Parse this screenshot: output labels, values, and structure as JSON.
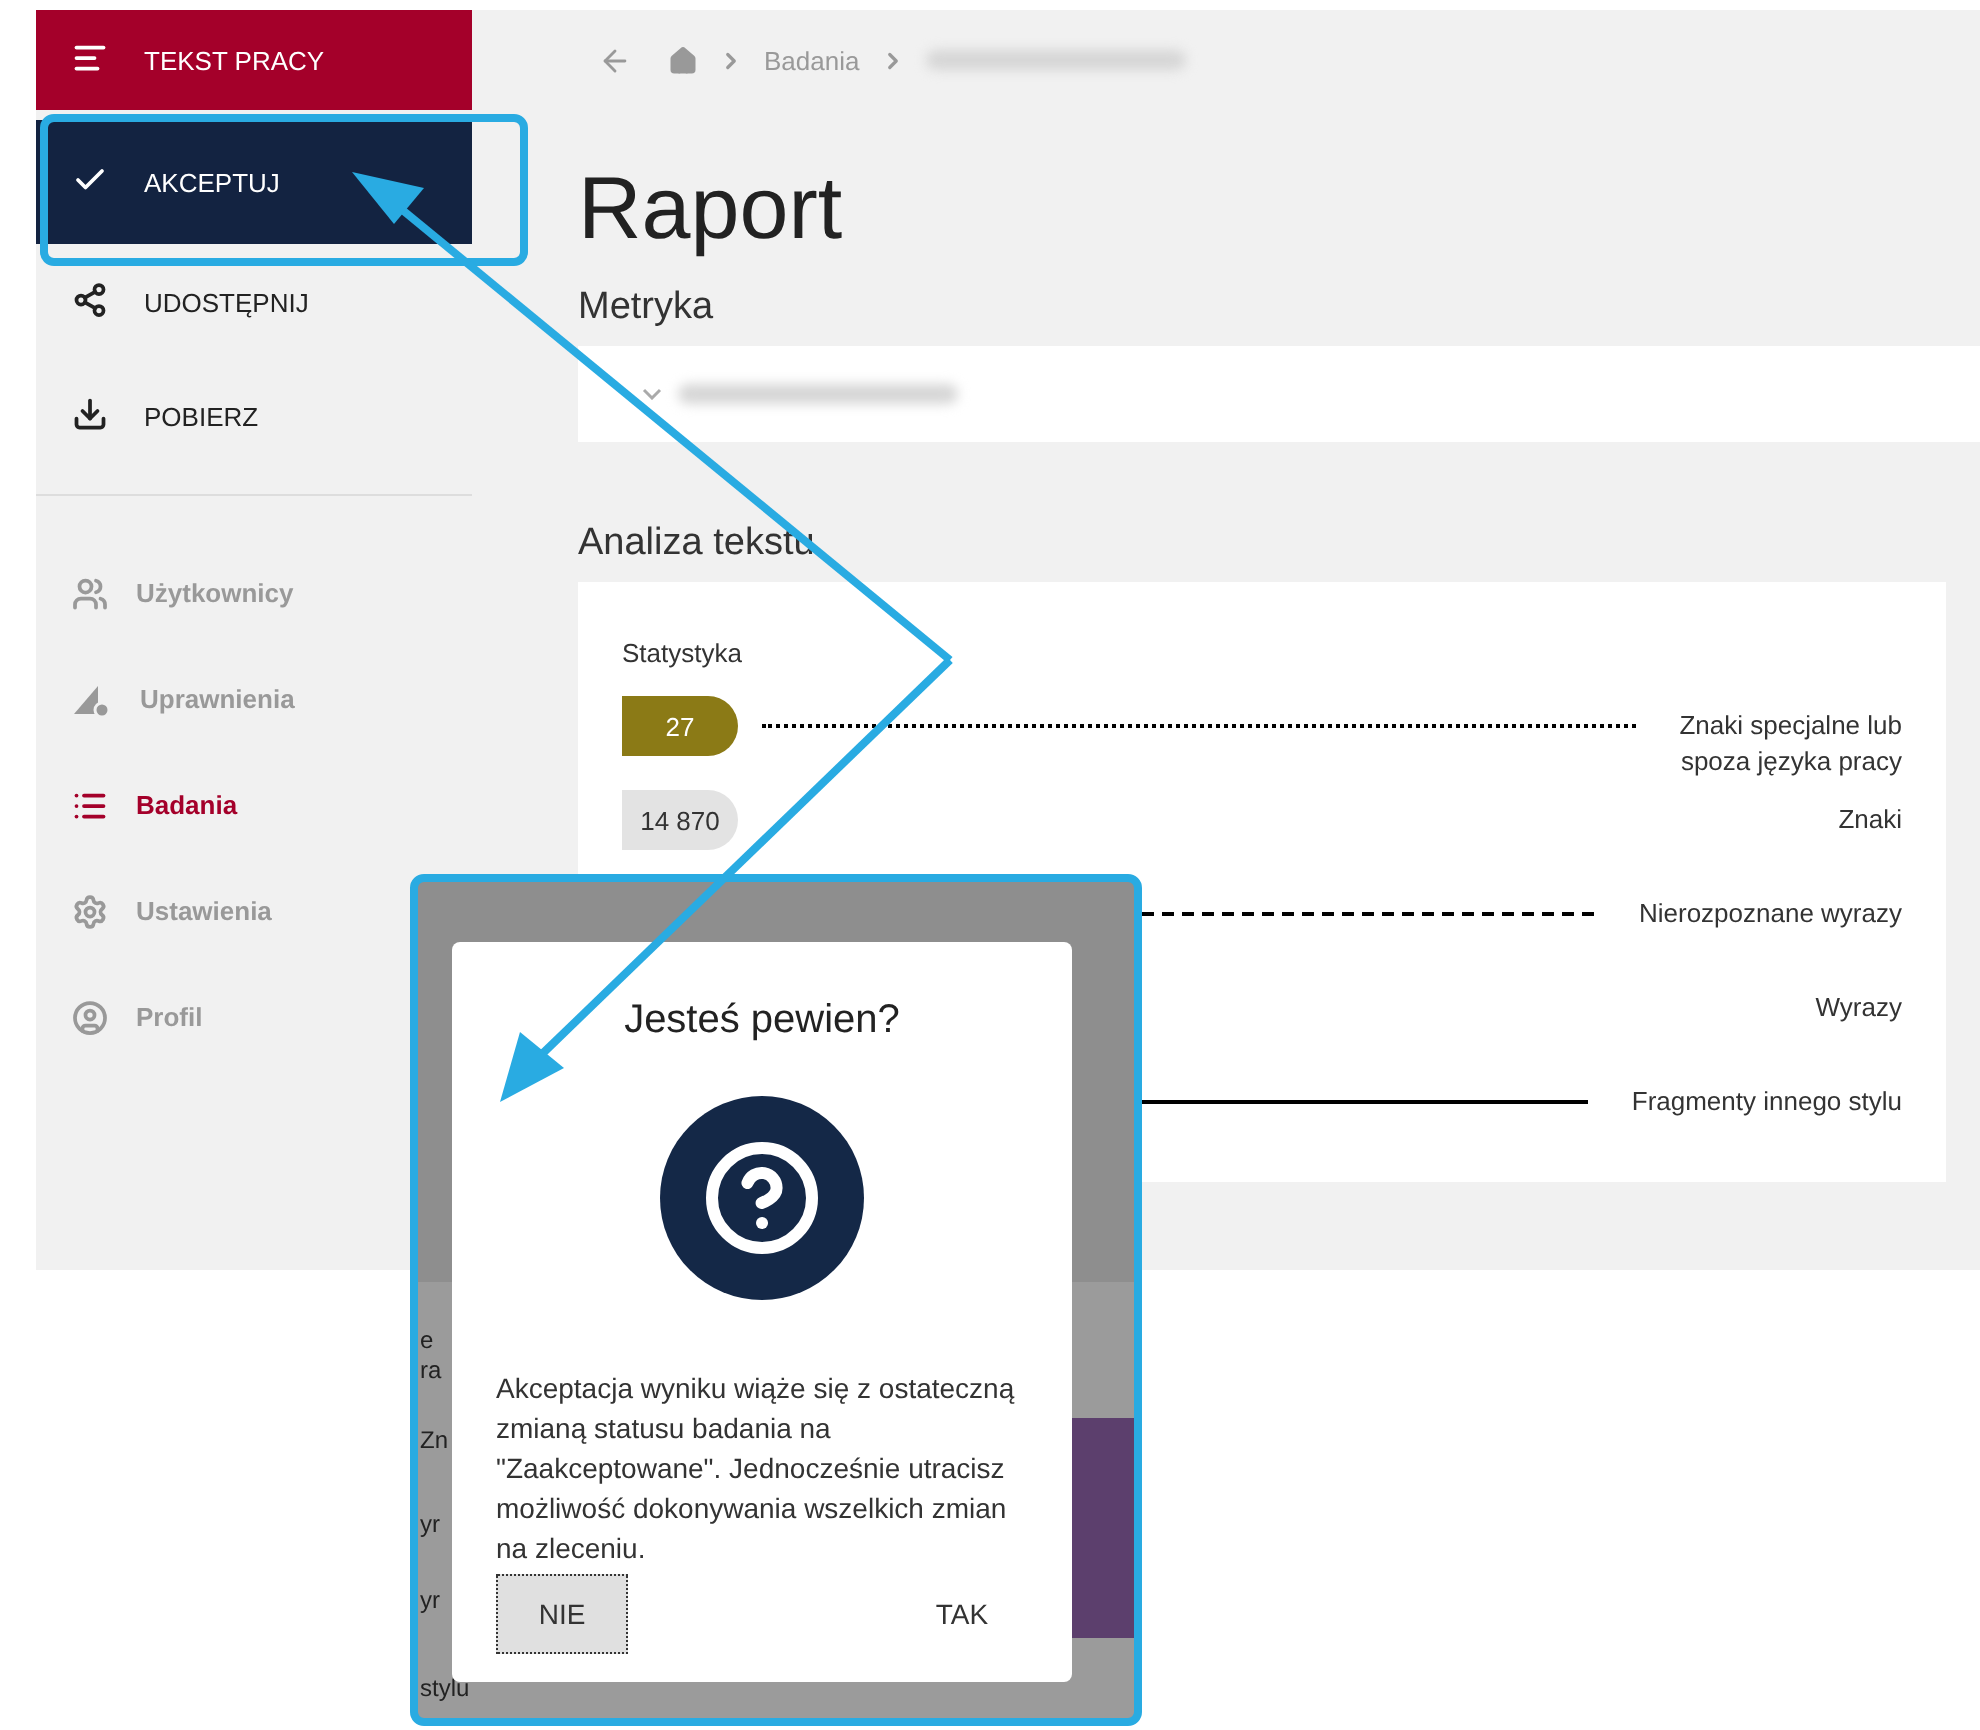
{
  "sidebar": {
    "actions": [
      {
        "label": "TEKST PRACY",
        "kind": "text"
      },
      {
        "label": "AKCEPTUJ",
        "kind": "accept"
      },
      {
        "label": "UDOSTĘPNIJ",
        "kind": "share"
      },
      {
        "label": "POBIERZ",
        "kind": "download"
      }
    ],
    "nav": [
      {
        "label": "Użytkownicy",
        "kind": "users",
        "selected": false
      },
      {
        "label": "Uprawnienia",
        "kind": "permissions",
        "selected": false
      },
      {
        "label": "Badania",
        "kind": "list",
        "selected": true
      },
      {
        "label": "Ustawienia",
        "kind": "settings",
        "selected": false
      },
      {
        "label": "Profil",
        "kind": "profile",
        "selected": false
      }
    ]
  },
  "breadcrumb": [
    "Badania"
  ],
  "page_title": "Raport",
  "metryka": {
    "title": "Metryka"
  },
  "analysis": {
    "title": "Analiza tekstu",
    "card_title": "Statystyka",
    "rows": [
      {
        "value": "27",
        "label": "Znaki specjalne lub\nspoza języka pracy",
        "kind": "dotted",
        "color": "#8b7a16"
      },
      {
        "value": "14 870",
        "label": "Znaki",
        "kind": "none",
        "color": "#e3e3e3"
      },
      {
        "label": "Nierozpoznane wyrazy",
        "kind": "dashed"
      },
      {
        "label": "Wyrazy",
        "kind": "none"
      },
      {
        "label": "Fragmenty innego stylu",
        "kind": "solid"
      }
    ]
  },
  "inset": {
    "background_labels": [
      "e",
      "ra",
      "Zn",
      "yr",
      "yr",
      "stylu"
    ]
  },
  "dialog": {
    "title": "Jesteś pewien?",
    "message": "Akceptacja wyniku wiąże się z ostateczną zmianą statusu badania na \"Zaakceptowane\". Jednocześnie utracisz możliwość dokonywania wszelkich zmian na zleceniu.",
    "buttons": [
      {
        "label": "NIE",
        "focused": true
      },
      {
        "label": "TAK",
        "focused": false
      }
    ]
  }
}
